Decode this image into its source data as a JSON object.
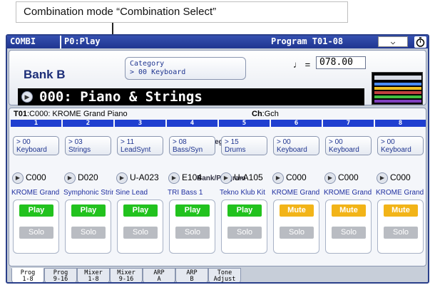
{
  "callout": "Combination mode “Combination Select”",
  "topbar": {
    "mode": "COMBI",
    "page": "P0:Play",
    "program": "Program T01-08",
    "menu_symbol": "⌵"
  },
  "header": {
    "bank": "Bank B",
    "category_line1": "Category",
    "category_line2": "> 00 Keyboard",
    "tempo_symbol": "♩ =",
    "tempo_value": "078.00",
    "combi_name": "000: Piano & Strings"
  },
  "timbre_info": {
    "label": "T01",
    "program": ":C000: KROME Grand Piano",
    "ch_label": "Ch",
    "ch_value": ":Gch"
  },
  "section_labels": {
    "category": "Category",
    "bank_program": "Bank/Program"
  },
  "timbres": [
    {
      "num": "1",
      "cat_num": "> 00",
      "cat_name": "Keyboard",
      "prog": "C000",
      "prog_name": "KROME Grand Piano",
      "play": "Play",
      "solo": "Solo"
    },
    {
      "num": "2",
      "cat_num": "> 03",
      "cat_name": "Strings",
      "prog": "D020",
      "prog_name": "Symphonic Strings",
      "play": "Play",
      "solo": "Solo"
    },
    {
      "num": "3",
      "cat_num": "> 11",
      "cat_name": "LeadSynt",
      "prog": "U-A023",
      "prog_name": "Sine Lead",
      "play": "Play",
      "solo": "Solo"
    },
    {
      "num": "4",
      "cat_num": "> 08",
      "cat_name": "Bass/Syn",
      "prog": "E104",
      "prog_name": "TRI Bass 1",
      "play": "Play",
      "solo": "Solo"
    },
    {
      "num": "5",
      "cat_num": "> 15",
      "cat_name": "Drums",
      "prog": "U-A105",
      "prog_name": "Tekno Klub Kit",
      "play": "Play",
      "solo": "Solo"
    },
    {
      "num": "6",
      "cat_num": "> 00",
      "cat_name": "Keyboard",
      "prog": "C000",
      "prog_name": "KROME Grand Piano",
      "play": "Mute",
      "solo": "Solo"
    },
    {
      "num": "7",
      "cat_num": "> 00",
      "cat_name": "Keyboard",
      "prog": "C000",
      "prog_name": "KROME Grand Piano",
      "play": "Mute",
      "solo": "Solo"
    },
    {
      "num": "8",
      "cat_num": "> 00",
      "cat_name": "Keyboard",
      "prog": "C000",
      "prog_name": "KROME Grand Piano",
      "play": "Mute",
      "solo": "Solo"
    }
  ],
  "colors": {
    "play": "#22c21e",
    "mute": "#f2b418",
    "accent": "#1f3fd0"
  },
  "tabs": [
    {
      "line1": "Prog",
      "line2": "1-8",
      "active": true
    },
    {
      "line1": "Prog",
      "line2": "9-16",
      "active": false
    },
    {
      "line1": "Mixer",
      "line2": "1-8",
      "active": false
    },
    {
      "line1": "Mixer",
      "line2": "9-16",
      "active": false
    },
    {
      "line1": "ARP",
      "line2": "A",
      "active": false
    },
    {
      "line1": "ARP",
      "line2": "B",
      "active": false
    },
    {
      "line1": "Tone",
      "line2": "Adjust",
      "active": false
    }
  ]
}
